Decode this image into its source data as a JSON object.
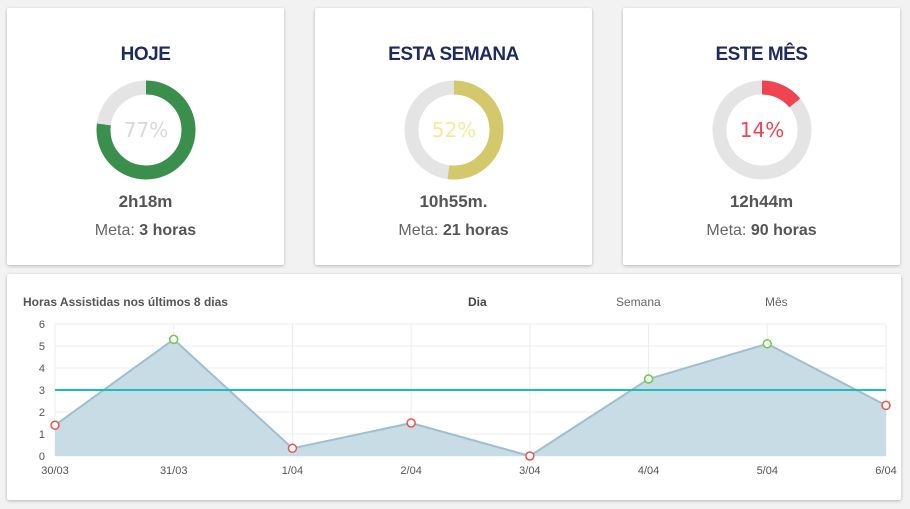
{
  "cards": [
    {
      "title": "HOJE",
      "percent_label": "77%",
      "percent": 0.77,
      "value": "2h18m",
      "goal_prefix": "Meta:",
      "goal_value": "3 horas",
      "ring_color": "#3a8f4c",
      "text_color": "#d9d9d9"
    },
    {
      "title": "ESTA SEMANA",
      "percent_label": "52%",
      "percent": 0.52,
      "value": "10h55m.",
      "goal_prefix": "Meta:",
      "goal_value": "21 horas",
      "ring_color": "#d4c96a",
      "text_color": "#f4eb9a"
    },
    {
      "title": "ESTE MÊS",
      "percent_label": "14%",
      "percent": 0.14,
      "value": "12h44m",
      "goal_prefix": "Meta:",
      "goal_value": "90 horas",
      "ring_color": "#f04550",
      "text_color": "#f04550"
    }
  ],
  "chart_panel": {
    "title": "Horas Assistidas nos últimos 8 dias",
    "tabs": [
      {
        "label": "Dia",
        "active": true
      },
      {
        "label": "Semana",
        "active": false
      },
      {
        "label": "Mês",
        "active": false
      }
    ]
  },
  "chart_data": {
    "type": "area",
    "title": "Horas Assistidas nos últimos 8 dias",
    "categories": [
      "30/03",
      "31/03",
      "1/04",
      "2/04",
      "3/04",
      "4/04",
      "5/04",
      "6/04"
    ],
    "series": [
      {
        "values": [
          1.4,
          5.3,
          0.35,
          1.5,
          0.0,
          3.5,
          5.1,
          2.3
        ]
      }
    ],
    "goal_line": 3,
    "ylim": [
      0,
      6
    ],
    "yticks": [
      0,
      1,
      2,
      3,
      4,
      5,
      6
    ],
    "grid": true,
    "colors": {
      "fill": "#c8dce6",
      "line": "#9ebfcf",
      "goal": "#1bbcbc",
      "above": "#66cc44",
      "below": "#e8554a"
    }
  }
}
